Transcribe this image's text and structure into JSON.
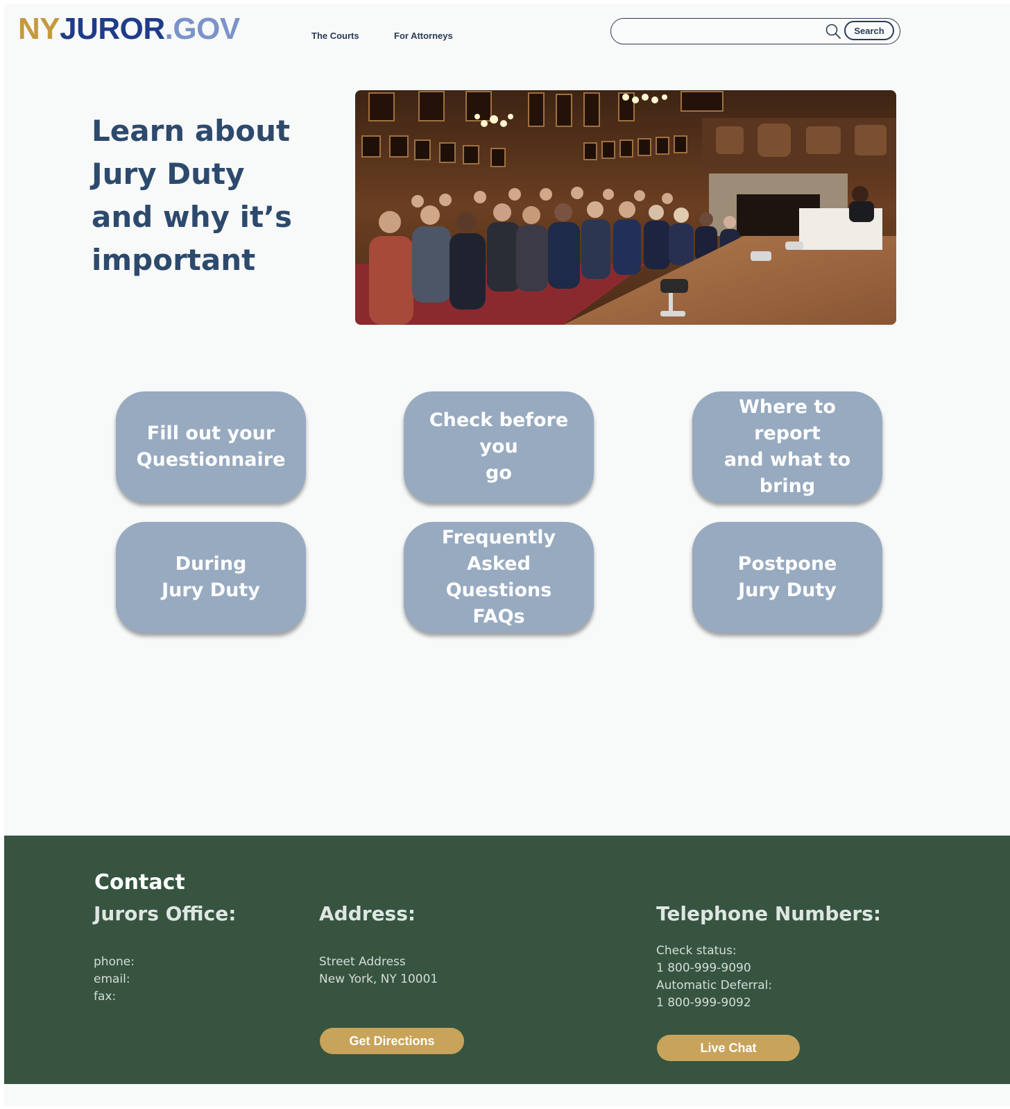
{
  "header": {
    "logo": {
      "part1": "NY",
      "part2": "JUROR",
      "part3": ".GOV"
    },
    "nav": [
      {
        "label": "The Courts"
      },
      {
        "label": "For Attorneys"
      }
    ],
    "search": {
      "value": "",
      "placeholder": "",
      "button_label": "Search"
    }
  },
  "hero": {
    "title_lines": [
      "Learn about",
      "Jury Duty",
      "and why it’s",
      "important"
    ],
    "image": "courtroom-photo"
  },
  "tiles": [
    {
      "label": "Fill out your\nQuestionnaire"
    },
    {
      "label": "Check before you\ngo"
    },
    {
      "label": "Where to report\nand what to\nbring"
    },
    {
      "label": "During\nJury Duty"
    },
    {
      "label": "Frequently\nAsked Questions\nFAQs"
    },
    {
      "label": "Postpone\nJury Duty"
    }
  ],
  "footer": {
    "title": "Contact",
    "jurors_office": {
      "heading": "Jurors Office:",
      "lines": "phone:\nemail:\nfax:"
    },
    "address": {
      "heading": "Address:",
      "lines": "Street Address\nNew York, NY 10001",
      "button_label": "Get Directions"
    },
    "telephone": {
      "heading": "Telephone Numbers:",
      "lines": "Check status:\n1 800-999-9090\nAutomatic Deferral:\n1 800-999-9092",
      "button_label": "Live Chat"
    }
  },
  "colors": {
    "logo_gold": "#c49a3f",
    "logo_blue": "#1f3c88",
    "logo_light_blue": "#7b93c8",
    "tile_bg": "#97aac0",
    "footer_bg": "#365440",
    "button_gold": "#c8a35a",
    "heading_blue": "#2d4a6d"
  }
}
